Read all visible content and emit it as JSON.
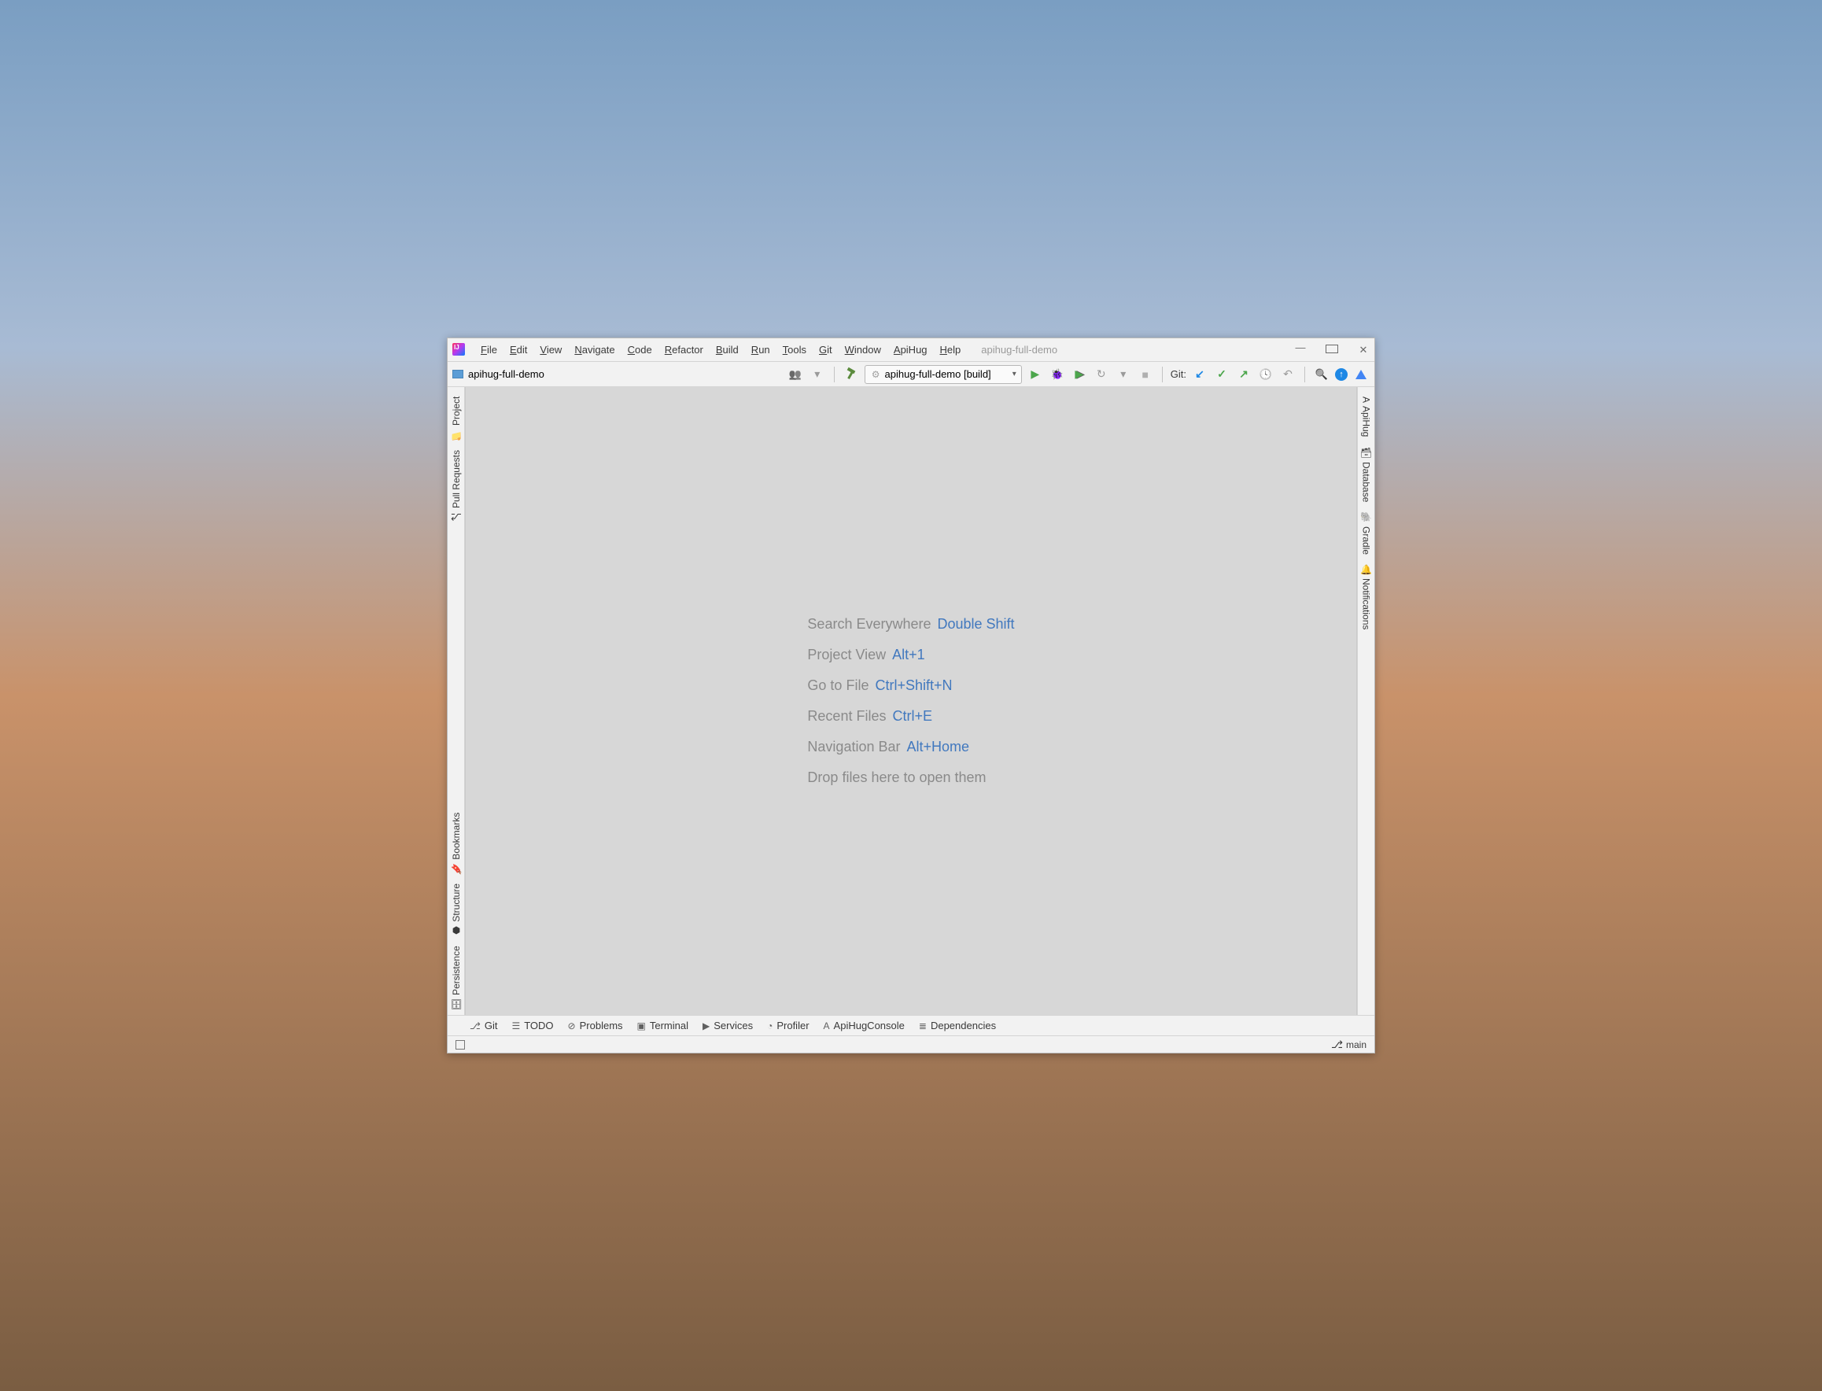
{
  "window": {
    "title": "apihug-full-demo"
  },
  "menu": {
    "items": [
      "File",
      "Edit",
      "View",
      "Navigate",
      "Code",
      "Refactor",
      "Build",
      "Run",
      "Tools",
      "Git",
      "Window",
      "ApiHug",
      "Help"
    ]
  },
  "nav": {
    "project": "apihug-full-demo"
  },
  "runConfig": {
    "label": "apihug-full-demo [build]"
  },
  "git": {
    "label": "Git:"
  },
  "leftStripe": {
    "top": [
      {
        "label": "Project",
        "icon": "folder"
      },
      {
        "label": "Pull Requests",
        "icon": "pr"
      }
    ],
    "bottom": [
      {
        "label": "Bookmarks",
        "icon": "bookmark"
      },
      {
        "label": "Structure",
        "icon": "structure"
      },
      {
        "label": "Persistence",
        "icon": "persistence"
      }
    ]
  },
  "rightStripe": {
    "top": [
      {
        "label": "ApiHug",
        "icon": "apihug"
      },
      {
        "label": "Database",
        "icon": "database"
      },
      {
        "label": "Gradle",
        "icon": "gradle"
      },
      {
        "label": "Notifications",
        "icon": "bell"
      }
    ]
  },
  "hints": [
    {
      "text": "Search Everywhere",
      "shortcut": "Double Shift"
    },
    {
      "text": "Project View",
      "shortcut": "Alt+1"
    },
    {
      "text": "Go to File",
      "shortcut": "Ctrl+Shift+N"
    },
    {
      "text": "Recent Files",
      "shortcut": "Ctrl+E"
    },
    {
      "text": "Navigation Bar",
      "shortcut": "Alt+Home"
    },
    {
      "text": "Drop files here to open them",
      "shortcut": ""
    }
  ],
  "bottomStripe": [
    {
      "label": "Git",
      "icon": "branch"
    },
    {
      "label": "TODO",
      "icon": "list"
    },
    {
      "label": "Problems",
      "icon": "warn"
    },
    {
      "label": "Terminal",
      "icon": "terminal"
    },
    {
      "label": "Services",
      "icon": "services"
    },
    {
      "label": "Profiler",
      "icon": "profiler"
    },
    {
      "label": "ApiHugConsole",
      "icon": "apihug"
    },
    {
      "label": "Dependencies",
      "icon": "deps"
    }
  ],
  "status": {
    "branch": "main"
  }
}
